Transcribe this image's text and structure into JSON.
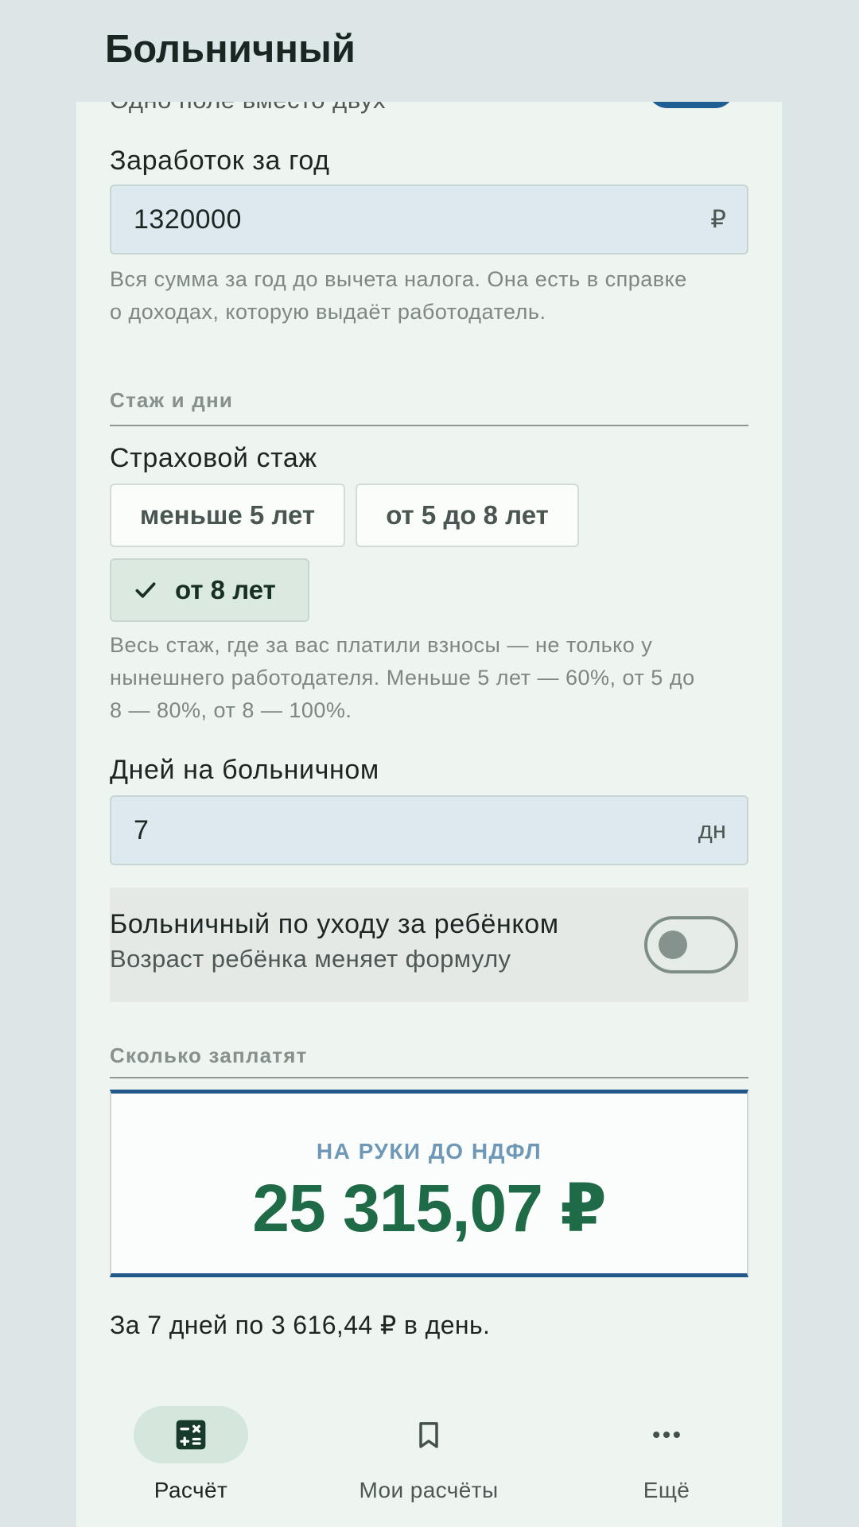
{
  "app_bar": {
    "title": "Больничный"
  },
  "peek": {
    "text": "Одно поле вместо двух"
  },
  "earnings": {
    "label": "Заработок за год",
    "value": "1320000",
    "suffix": "₽",
    "helper_line1": "Вся сумма за год до вычета налога. Она есть в справке",
    "helper_line2": "о доходах, которую выдаёт работодатель."
  },
  "section_experience": {
    "title": "Стаж и дни"
  },
  "insurance": {
    "label": "Страховой стаж",
    "options": [
      {
        "label": "меньше 5 лет",
        "selected": false
      },
      {
        "label": "от 5 до 8 лет",
        "selected": false
      },
      {
        "label": "от 8 лет",
        "selected": true
      }
    ],
    "helper_line1": "Весь стаж, где за вас платили взносы — не только у",
    "helper_line2": "нынешнего работодателя. Меньше 5 лет — 60%, от 5 до",
    "helper_line3": "8 — 80%, от 8 — 100%."
  },
  "days": {
    "label": "Дней на больничном",
    "value": "7",
    "suffix": "дн"
  },
  "child_care": {
    "title": "Больничный по уходу за ребёнком",
    "subtitle": "Возраст ребёнка меняет формулу",
    "enabled": false
  },
  "section_result": {
    "title": "Сколько заплатят"
  },
  "result": {
    "label": "НА РУКИ ДО НДФЛ",
    "amount": "25 315,07 ₽",
    "note": "За 7 дней по 3 616,44 ₽ в день."
  },
  "nav": {
    "items": [
      {
        "label": "Расчёт",
        "icon": "calculator-icon",
        "active": true
      },
      {
        "label": "Мои расчёты",
        "icon": "bookmark-icon",
        "active": false
      },
      {
        "label": "Ещё",
        "icon": "more-horizontal-icon",
        "active": false
      }
    ]
  },
  "colors": {
    "accent_blue": "#22578a",
    "amount_green": "#1f6a47",
    "nav_active_pill": "#d5e6dc"
  }
}
